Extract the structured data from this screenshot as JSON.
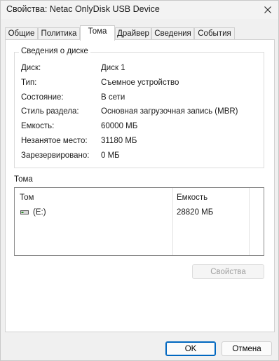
{
  "window": {
    "title": "Свойства: Netac OnlyDisk USB Device"
  },
  "tabs": [
    "Общие",
    "Политика",
    "Тома",
    "Драйвер",
    "Сведения",
    "События"
  ],
  "disk_info": {
    "legend": "Сведения о диске",
    "rows": [
      {
        "label": "Диск:",
        "value": "Диск 1"
      },
      {
        "label": "Тип:",
        "value": "Съемное устройство"
      },
      {
        "label": "Состояние:",
        "value": "В сети"
      },
      {
        "label": "Стиль раздела:",
        "value": "Основная загрузочная запись (MBR)"
      },
      {
        "label": "Емкость:",
        "value": "60000 МБ"
      },
      {
        "label": "Незанятое место:",
        "value": "31180 МБ"
      },
      {
        "label": "Зарезервировано:",
        "value": "0 МБ"
      }
    ]
  },
  "volumes": {
    "label": "Тома",
    "columns": [
      "Том",
      "Емкость"
    ],
    "rows": [
      {
        "volume": "(E:)",
        "capacity": "28820 МБ"
      }
    ]
  },
  "buttons": {
    "properties": "Свойства",
    "ok": "OK",
    "cancel": "Отмена"
  }
}
